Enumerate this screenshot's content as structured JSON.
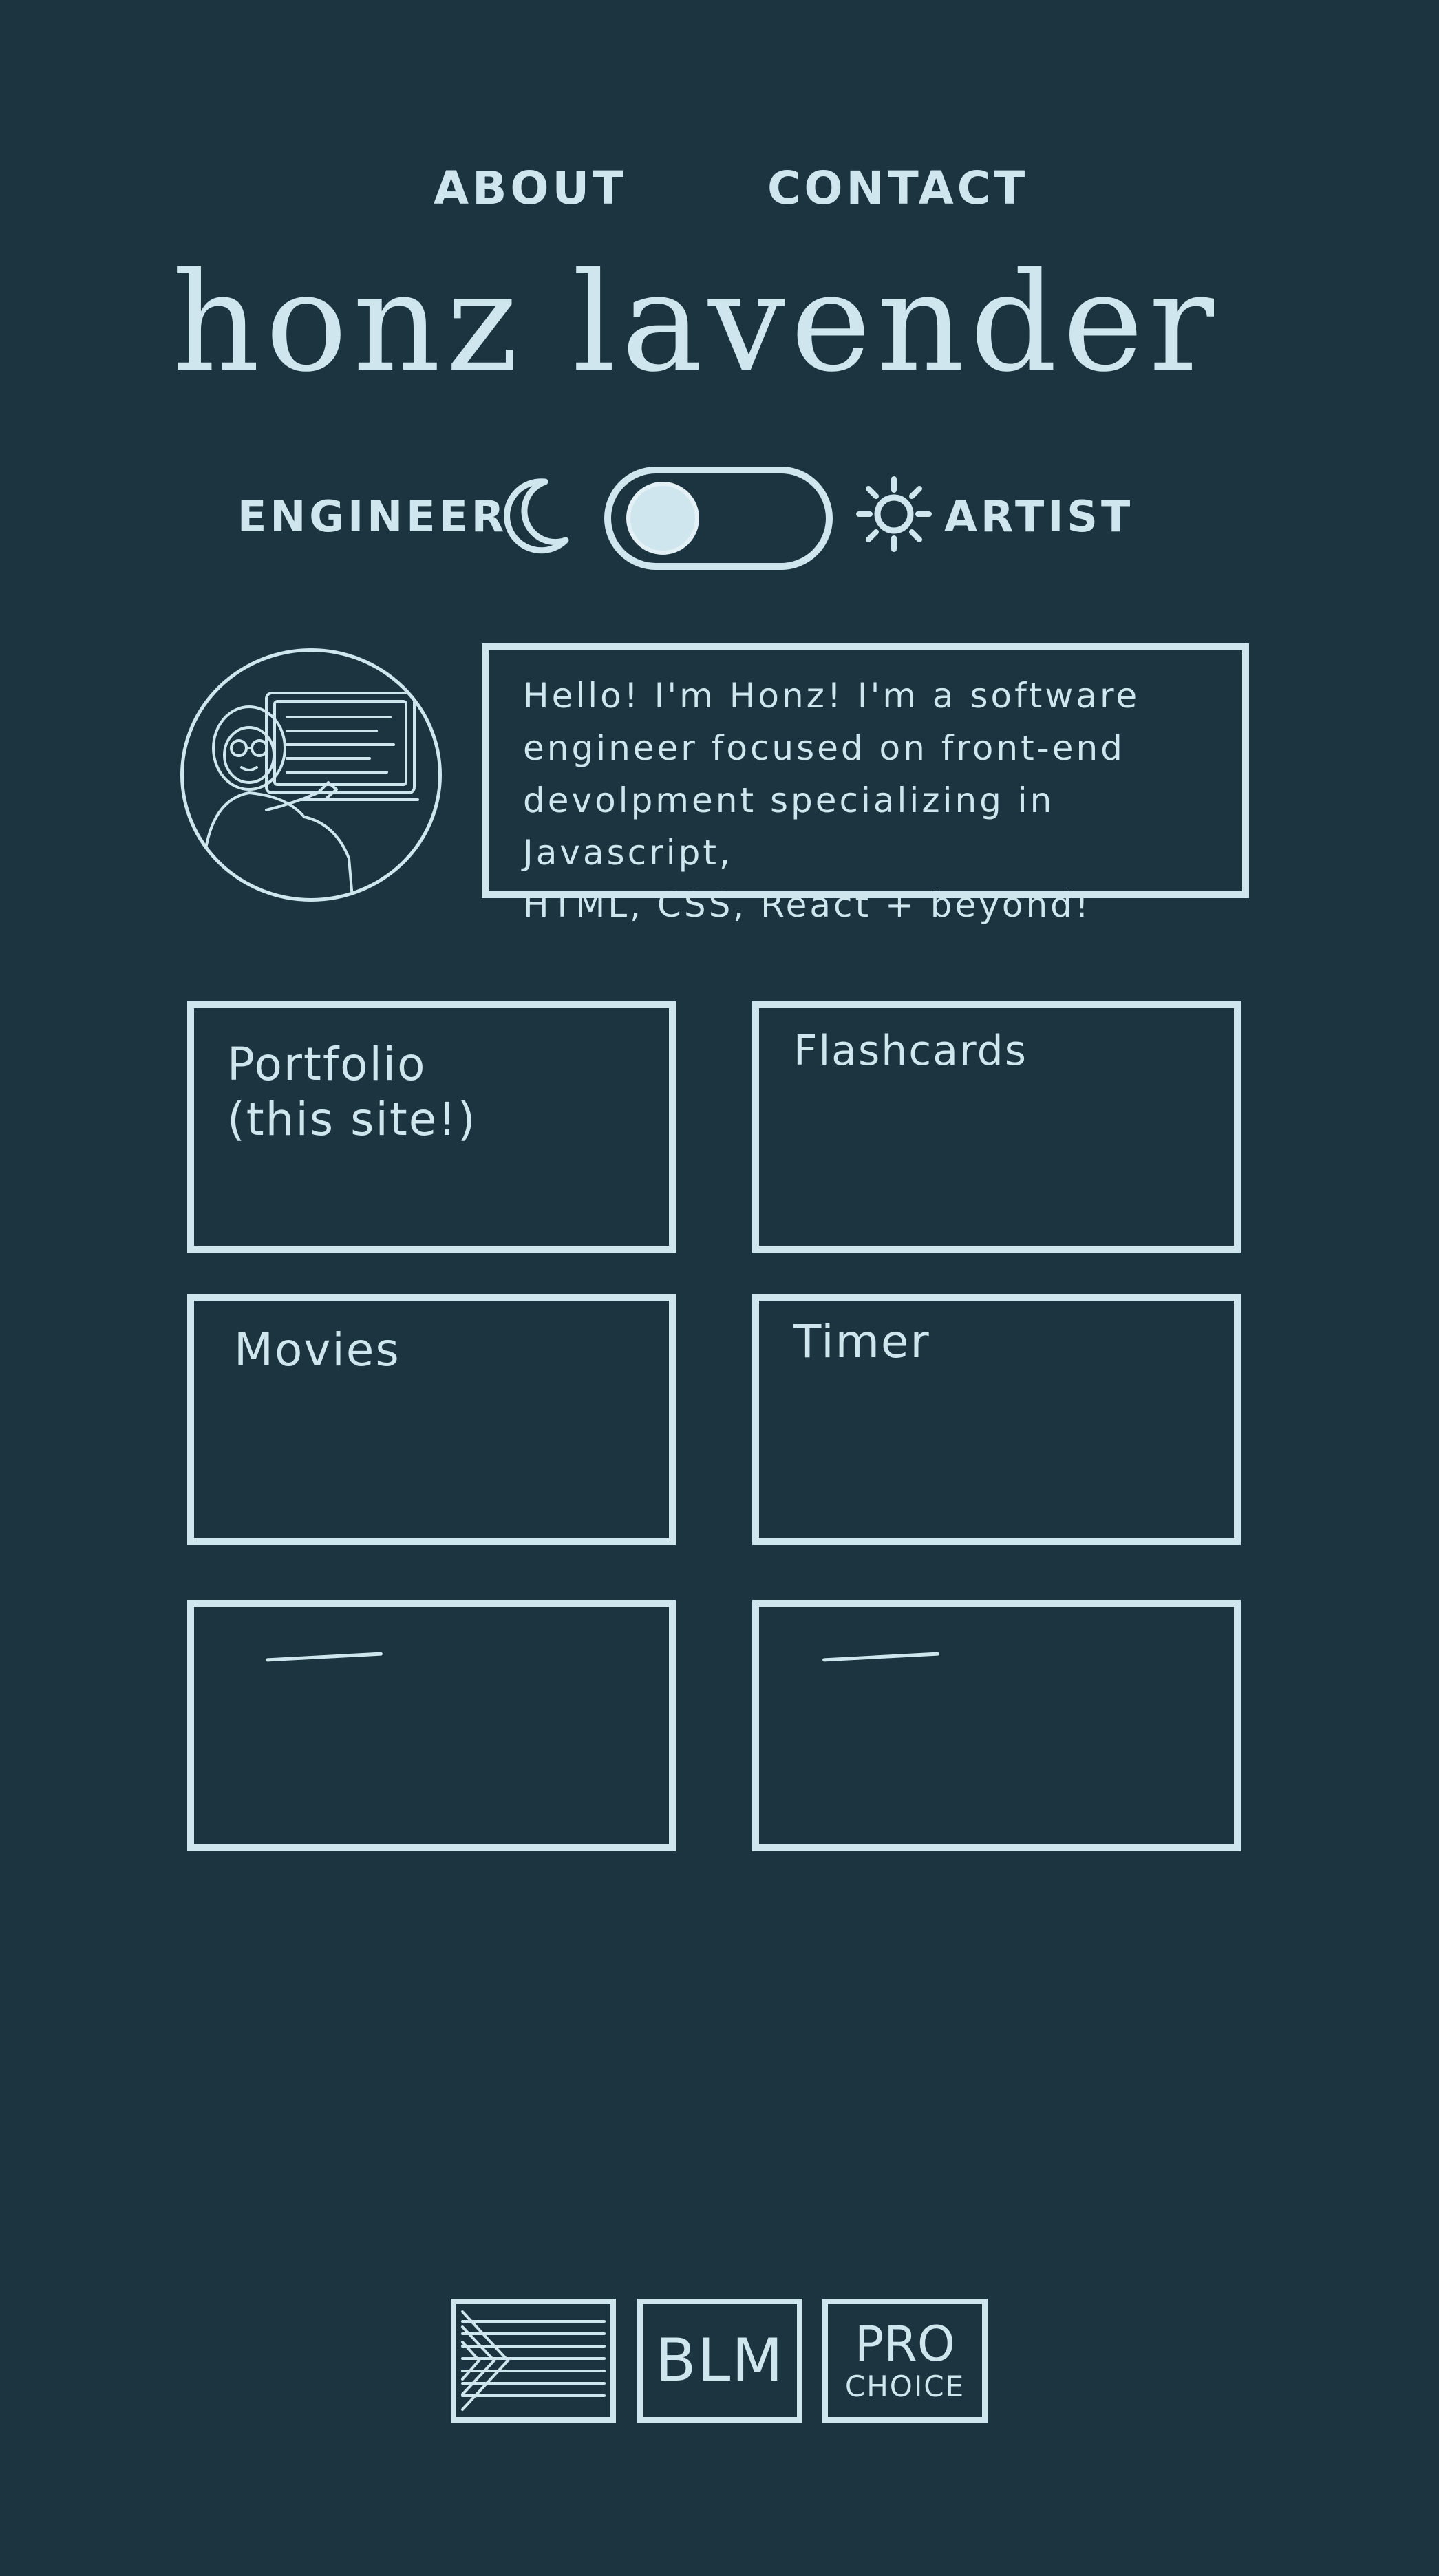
{
  "nav": {
    "about_label": "ABOUT",
    "contact_label": "CONTACT"
  },
  "site": {
    "title": "honz lavender"
  },
  "mode_toggle": {
    "left_label": "ENGINEER",
    "right_label": "ARTIST",
    "left_icon": "moon-icon",
    "right_icon": "sun-icon",
    "selected": "ENGINEER"
  },
  "profile": {
    "avatar_icon": "person-at-computer-illustration",
    "bio_lines": [
      "Hello! I'm Honz! I'm a software",
      "engineer focused on front-end",
      "devolpment specializing in Javascript,",
      "HTML, CSS, React + beyond!"
    ]
  },
  "projects": [
    {
      "title": "Portfolio\n(this site!)"
    },
    {
      "title": "Flashcards"
    },
    {
      "title": "Movies"
    },
    {
      "title": "Timer"
    },
    {
      "title": ""
    },
    {
      "title": ""
    }
  ],
  "footer": {
    "badges": [
      {
        "name": "flag-icon",
        "label": ""
      },
      {
        "name": "blm-badge",
        "label": "BLM"
      },
      {
        "name": "pro-choice-badge",
        "label_top": "PRO",
        "label_bottom": "CHOICE"
      }
    ]
  },
  "colors": {
    "background": "#1b3440",
    "chalk": "#cfe6ee"
  }
}
